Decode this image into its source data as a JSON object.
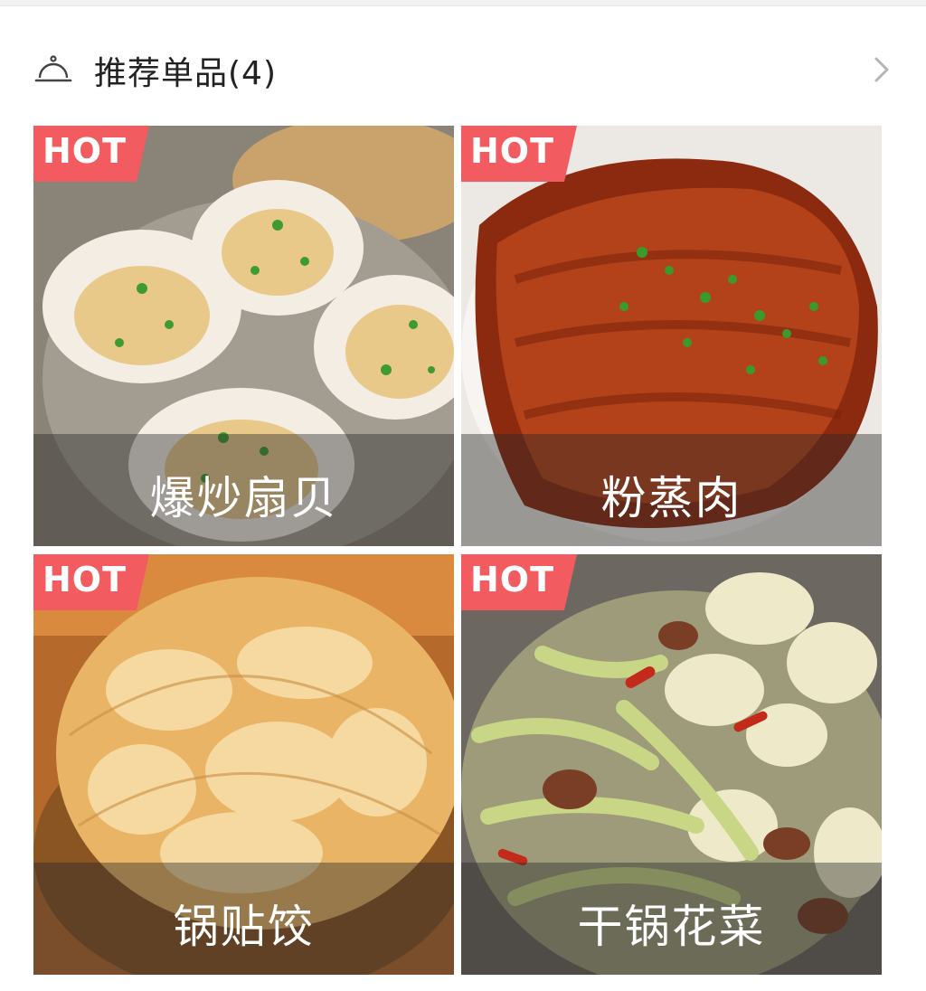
{
  "section": {
    "title": "推荐单品(4)",
    "leading_icon": "dish-cover-icon",
    "trailing_icon": "chevron-right-icon"
  },
  "colors": {
    "hot_badge": "#f25b60",
    "caption_overlay": "rgba(40,40,40,0.42)"
  },
  "items": [
    {
      "name": "爆炒扇贝",
      "badge": "HOT",
      "photo": "scallops"
    },
    {
      "name": "粉蒸肉",
      "badge": "HOT",
      "photo": "steamed-pork"
    },
    {
      "name": "锅贴饺",
      "badge": "HOT",
      "photo": "potstickers"
    },
    {
      "name": "干锅花菜",
      "badge": "HOT",
      "photo": "griddle-cauliflower"
    }
  ]
}
